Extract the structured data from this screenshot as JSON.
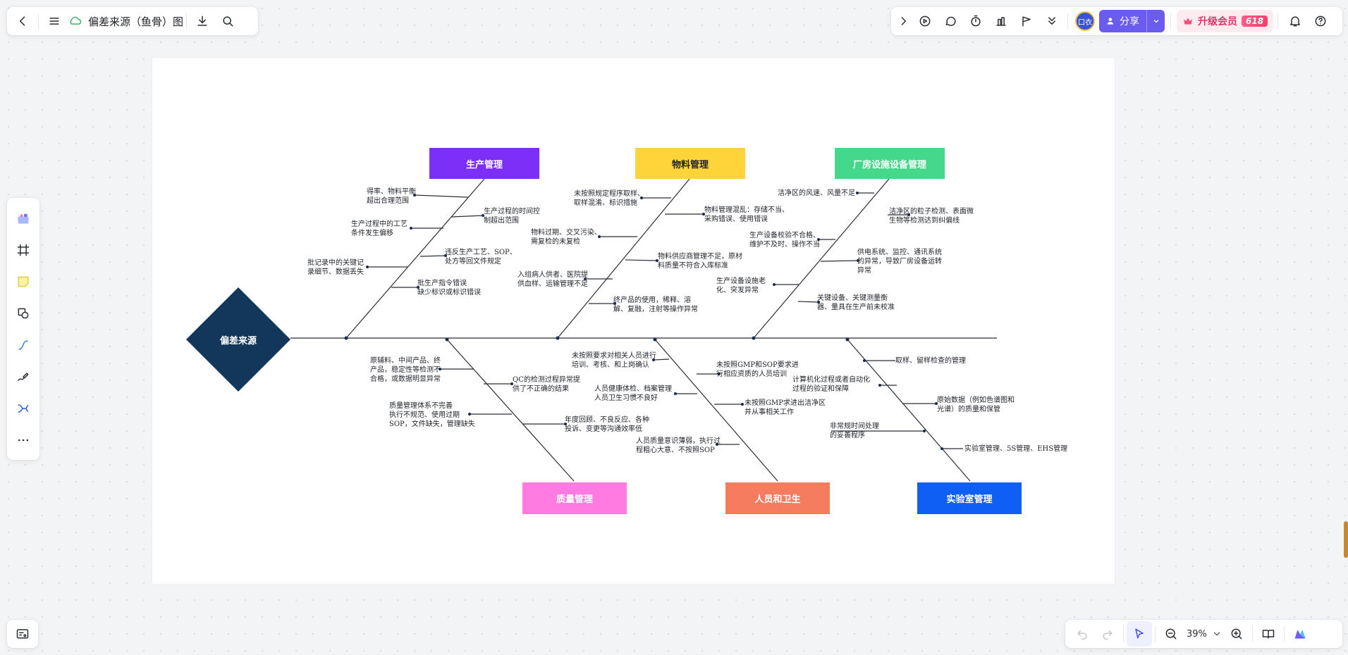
{
  "toolbar": {
    "doc_title": "偏差来源（鱼骨）图",
    "share_label": "分享",
    "upgrade_label": "升级会员",
    "upgrade_badge": "618",
    "avatar_text": "口衣"
  },
  "zoom": {
    "level": "39%"
  },
  "diagram": {
    "head": "偏差来源",
    "categories": {
      "c1": "生产管理",
      "c2": "物料管理",
      "c3": "厂房设施设备管理",
      "c4": "质量管理",
      "c5": "人员和卫生",
      "c6": "实验室管理"
    },
    "colors": {
      "head": "#13375a",
      "c1": "#7b2ff7",
      "c2": "#ffd43b",
      "c3": "#44d98a",
      "c4": "#ff7ae1",
      "c5": "#f67c5f",
      "c6": "#0f5ff5"
    },
    "causes": {
      "p1": "得率、物料平衡\n超出合理范围",
      "p2": "生产过程的时间控\n制超出范围",
      "p3": "生产过程中的工艺\n条件发生偏移",
      "p4": "违反生产工艺、SOP、\n处方等回文件规定",
      "p5": "批记录中的关键记\n录细节、数据丢失",
      "p6": "批生产指令错误\n缺少标识或标识错误",
      "m1": "未按照规定程序取样、\n取样混淆、标识措施",
      "m2": "物料管理混乱：存储不当、\n采购错误、使用错误",
      "m3": "物料过期、交叉污染、\n需复检的未复检",
      "m4": "物料供应商管理不足，原材\n料质量不符合入库标准",
      "m5": "入组病人供者、医院提\n供血样、运输管理不足",
      "m6": "终产品的使用，稀释、溶\n解、复融，注射等操作异常",
      "f1": "洁净区的风速、风量不足",
      "f2": "洁净区的粒子检测、表面微\n生物等检测达到纠偏线",
      "f3": "生产设备校验不合格、\n维护不及时、操作不当",
      "f4": "供电系统、监控、通讯系统\n的异常，导致厂房设备运转\n异常",
      "f5": "生产设备设施老\n化、突发异常",
      "f6": "关键设备、关键测量衡\n器、量具在生产前未校准",
      "q1": "原辅料、中间产品、终\n产品，稳定性等检测不\n合格，或数据明显异常",
      "q2": "QC的检测过程异常提\n供了不正确的结果",
      "q3": "质量管理体系不完善\n执行不规范、使用过期\nSOP，文件缺失，管理缺失",
      "q4": "年度回顾、不良反应、各种\n投诉、变更等沟通效率低",
      "h1": "未按照要求对相关人员进行\n培训、考核、和上岗确认",
      "h2": "未按照GMP和SOP要求进\n行相应资质的人员培训",
      "h3": "人员健康体检、档案管理\n人员卫生习惯不良好",
      "h4": "未按照GMP求进出洁净区\n并从事相关工作",
      "h5": "人员质量意识薄弱，执行过\n程粗心大意、不按照SOP",
      "l1": "取样、留样检查的管理",
      "l2": "计算机化过程或者自动化\n过程的验证和保障",
      "l3": "原始数据（例如色谱图和\n光谱）的质量和保管",
      "l4": "非常规时间处理\n的妥善程序",
      "l5": "实验室管理、5S管理、EHS管理"
    }
  }
}
